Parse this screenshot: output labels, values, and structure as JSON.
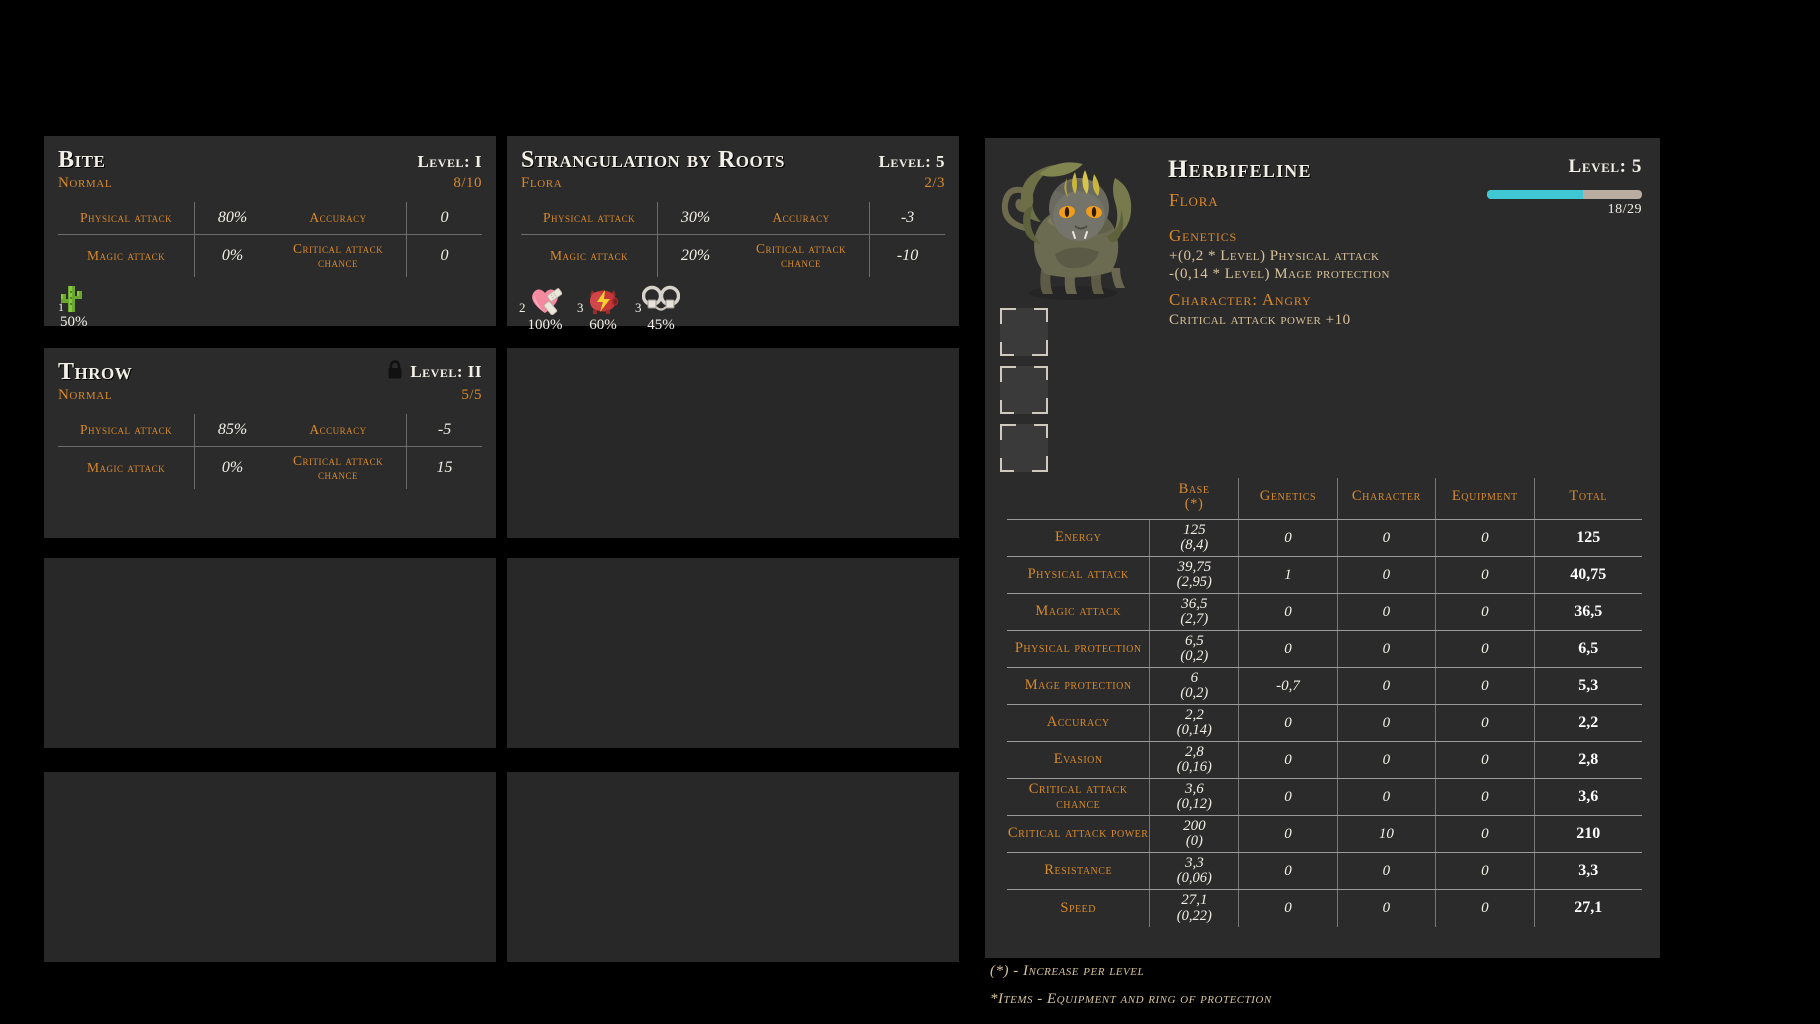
{
  "skill_cards": [
    {
      "name": "Bite",
      "type": "Normal",
      "level": "Level: I",
      "uses": "8/10",
      "locked": false,
      "rows": [
        {
          "label": "Physical attack",
          "value": "80%",
          "label2": "Accuracy",
          "value2": "0"
        },
        {
          "label": "Magic attack",
          "value": "0%",
          "label2": "Critical attack chance",
          "value2": "0"
        }
      ],
      "effects": [
        {
          "icon": "cactus-icon",
          "count": "1",
          "chance": "50%"
        }
      ]
    },
    {
      "name": "Strangulation by Roots",
      "type": "Flora",
      "level": "Level: 5",
      "uses": "2/3",
      "locked": false,
      "rows": [
        {
          "label": "Physical attack",
          "value": "30%",
          "label2": "Accuracy",
          "value2": "-3"
        },
        {
          "label": "Magic attack",
          "value": "20%",
          "label2": "Critical attack chance",
          "value2": "-10"
        }
      ],
      "effects": [
        {
          "icon": "bandaged-heart-icon",
          "count": "2",
          "chance": "100%"
        },
        {
          "icon": "shock-pig-icon",
          "count": "3",
          "chance": "60%"
        },
        {
          "icon": "handcuffs-icon",
          "count": "3",
          "chance": "45%"
        }
      ]
    },
    {
      "name": "Throw",
      "type": "Normal",
      "level": "Level: II",
      "uses": "5/5",
      "locked": true,
      "rows": [
        {
          "label": "Physical attack",
          "value": "85%",
          "label2": "Accuracy",
          "value2": "-5"
        },
        {
          "label": "Magic attack",
          "value": "0%",
          "label2": "Critical attack chance",
          "value2": "15"
        }
      ],
      "effects": []
    }
  ],
  "empty_slots": 5,
  "creature": {
    "name": "Herbifeline",
    "type": "Flora",
    "level": "Level: 5",
    "xp_text": "18/29",
    "xp_current": 18,
    "xp_max": 29,
    "xp_percent": 62,
    "genetics_heading": "Genetics",
    "genetics_lines": [
      "+(0,2 * Level) Physical attack",
      "-(0,14 * Level) Mage protection"
    ],
    "character_heading": "Character: Angry",
    "character_line": "Critical attack power +10",
    "equipment_slots": 3
  },
  "stats_table": {
    "headers": {
      "name": "",
      "base": "Base",
      "base_sub": "(*)",
      "genetics": "Genetics",
      "character": "Character",
      "equipment": "Equipment",
      "total": "Total"
    },
    "rows": [
      {
        "name": "Energy",
        "base": "125",
        "per_level": "(8,4)",
        "genetics": "0",
        "character": "0",
        "equipment": "0",
        "total": "125"
      },
      {
        "name": "Physical attack",
        "base": "39,75",
        "per_level": "(2,95)",
        "genetics": "1",
        "character": "0",
        "equipment": "0",
        "total": "40,75"
      },
      {
        "name": "Magic attack",
        "base": "36,5",
        "per_level": "(2,7)",
        "genetics": "0",
        "character": "0",
        "equipment": "0",
        "total": "36,5"
      },
      {
        "name": "Physical protection",
        "base": "6,5",
        "per_level": "(0,2)",
        "genetics": "0",
        "character": "0",
        "equipment": "0",
        "total": "6,5"
      },
      {
        "name": "Mage protection",
        "base": "6",
        "per_level": "(0,2)",
        "genetics": "-0,7",
        "character": "0",
        "equipment": "0",
        "total": "5,3"
      },
      {
        "name": "Accuracy",
        "base": "2,2",
        "per_level": "(0,14)",
        "genetics": "0",
        "character": "0",
        "equipment": "0",
        "total": "2,2"
      },
      {
        "name": "Evasion",
        "base": "2,8",
        "per_level": "(0,16)",
        "genetics": "0",
        "character": "0",
        "equipment": "0",
        "total": "2,8"
      },
      {
        "name": "Critical attack chance",
        "base": "3,6",
        "per_level": "(0,12)",
        "genetics": "0",
        "character": "0",
        "equipment": "0",
        "total": "3,6"
      },
      {
        "name": "Critical attack power",
        "base": "200",
        "per_level": "(0)",
        "genetics": "0",
        "character": "10",
        "equipment": "0",
        "total": "210"
      },
      {
        "name": "Resistance",
        "base": "3,3",
        "per_level": "(0,06)",
        "genetics": "0",
        "character": "0",
        "equipment": "0",
        "total": "3,3"
      },
      {
        "name": "Speed",
        "base": "27,1",
        "per_level": "(0,22)",
        "genetics": "0",
        "character": "0",
        "equipment": "0",
        "total": "27,1"
      }
    ]
  },
  "footnotes": {
    "line1": "(*) - Increase per level",
    "line2": "*Items - Equipment and ring of protection"
  },
  "colors": {
    "background": "#000000",
    "panel": "#2b2b2b",
    "empty_slot": "#282828",
    "accent_orange": "#d8892c",
    "text_cream": "#f2efe6",
    "text_tan": "#d8c39a",
    "xp_fill": "#3fc8d4",
    "xp_track": "#b9aca0",
    "divider": "#787878"
  }
}
